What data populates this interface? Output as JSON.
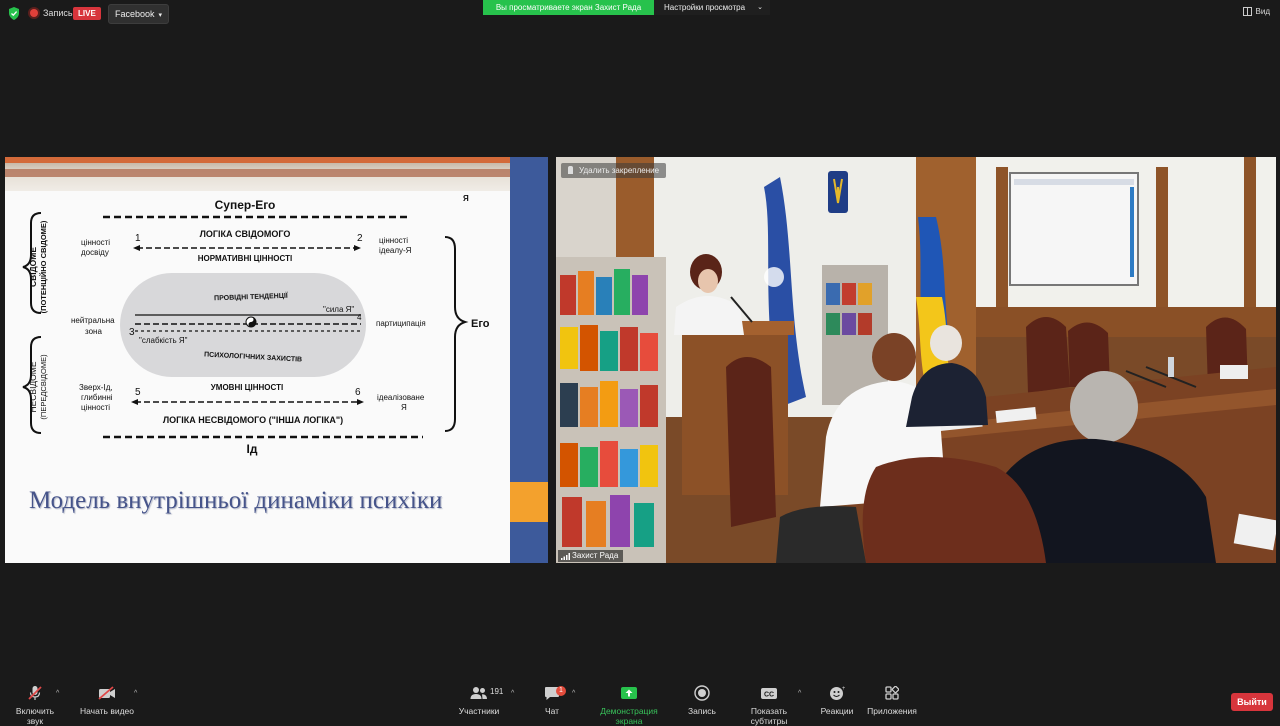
{
  "top": {
    "recording_label": "Запись",
    "live_label": "LIVE",
    "stream_target": "Facebook",
    "share_banner": "Вы просматриваете экран Захист Рада",
    "view_options": "Настройки просмотра",
    "view_button": "Вид"
  },
  "slide": {
    "title": "Модель внутрішньої динаміки психіки",
    "super_ego": "Супер-Его",
    "ya_top": "Я",
    "ego": "Его",
    "id": "Ід",
    "conscious": "СВІДОМЕ",
    "conscious_sub": "(ПОТЕНЦІЙНО СВІДОМЕ)",
    "unconscious": "НЕСВІДОМЕ",
    "unconscious_sub": "(ПЕРЕДСВІДОМЕ)",
    "logic_conscious": "ЛОГІКА СВІДОМОГО",
    "normative_values": "НОРМАТИВНІ ЦІННОСТІ",
    "values_experience_1": "цінності",
    "values_experience_2": "досвіду",
    "values_ideal_1": "цінності",
    "values_ideal_2": "ідеалу-Я",
    "leading_tendencies": "ПРОВІДНІ ТЕНДЕНЦІЇ",
    "strength_ya": "\"сила Я\"",
    "weakness_ya": "\"слабкість Я\"",
    "defenses": "ПСИХОЛОГІЧНИХ ЗАХИСТІВ",
    "neutral_zone_1": "нейтральна",
    "neutral_zone_2": "зона",
    "participation": "партиципація",
    "conditional_values": "УМОВНІ ЦІННОСТІ",
    "superid_1": "Зверх-Ід,",
    "superid_2": "глибинні",
    "superid_3": "цінності",
    "idealized_1": "ідеалізоване",
    "idealized_2": "Я",
    "logic_unconscious": "ЛОГІКА НЕСВІДОМОГО (\"ІНША ЛОГІКА\")",
    "n1": "1",
    "n2": "2",
    "n3": "3",
    "n4": "4",
    "n5": "5",
    "n6": "6"
  },
  "video": {
    "unpin_label": "Удалить закрепление",
    "participant_name": "Захист Рада"
  },
  "toolbar": {
    "unmute": "Включить звук",
    "start_video": "Начать видео",
    "participants": "Участники",
    "participants_count": "191",
    "chat": "Чат",
    "chat_badge": "1",
    "share": "Демонстрация экрана",
    "record": "Запись",
    "captions": "Показать субтитры",
    "captions_icon_text": "CC",
    "reactions": "Реакции",
    "apps": "Приложения",
    "leave": "Выйти"
  },
  "colors": {
    "share_green": "#27c24c",
    "live_red": "#d7353c",
    "slide_blue": "#3d5a9b",
    "slide_orange": "#f3a12d",
    "title_color": "#46548a"
  }
}
